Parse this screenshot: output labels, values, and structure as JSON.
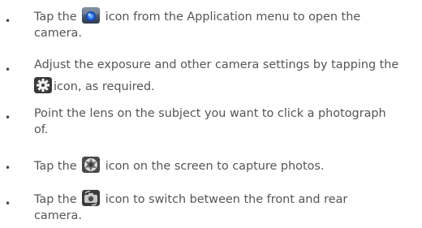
{
  "steps": [
    {
      "before": "Tap the",
      "icon": "camera-app-icon",
      "after": "icon from the Application menu to open the",
      "line2": "camera."
    },
    {
      "line1": "Adjust the exposure and other camera settings by tapping the",
      "icon": "settings-gear-icon",
      "after": "icon, as required."
    },
    {
      "line1": "Point the lens on the subject you want to click a photograph",
      "line2": "of."
    },
    {
      "before": "Tap the",
      "icon": "shutter-icon",
      "after": "icon on the screen to capture photos."
    },
    {
      "before": "Tap the",
      "icon": "switch-camera-icon",
      "after": "icon to switch between the front and rear",
      "line2": "camera."
    }
  ]
}
